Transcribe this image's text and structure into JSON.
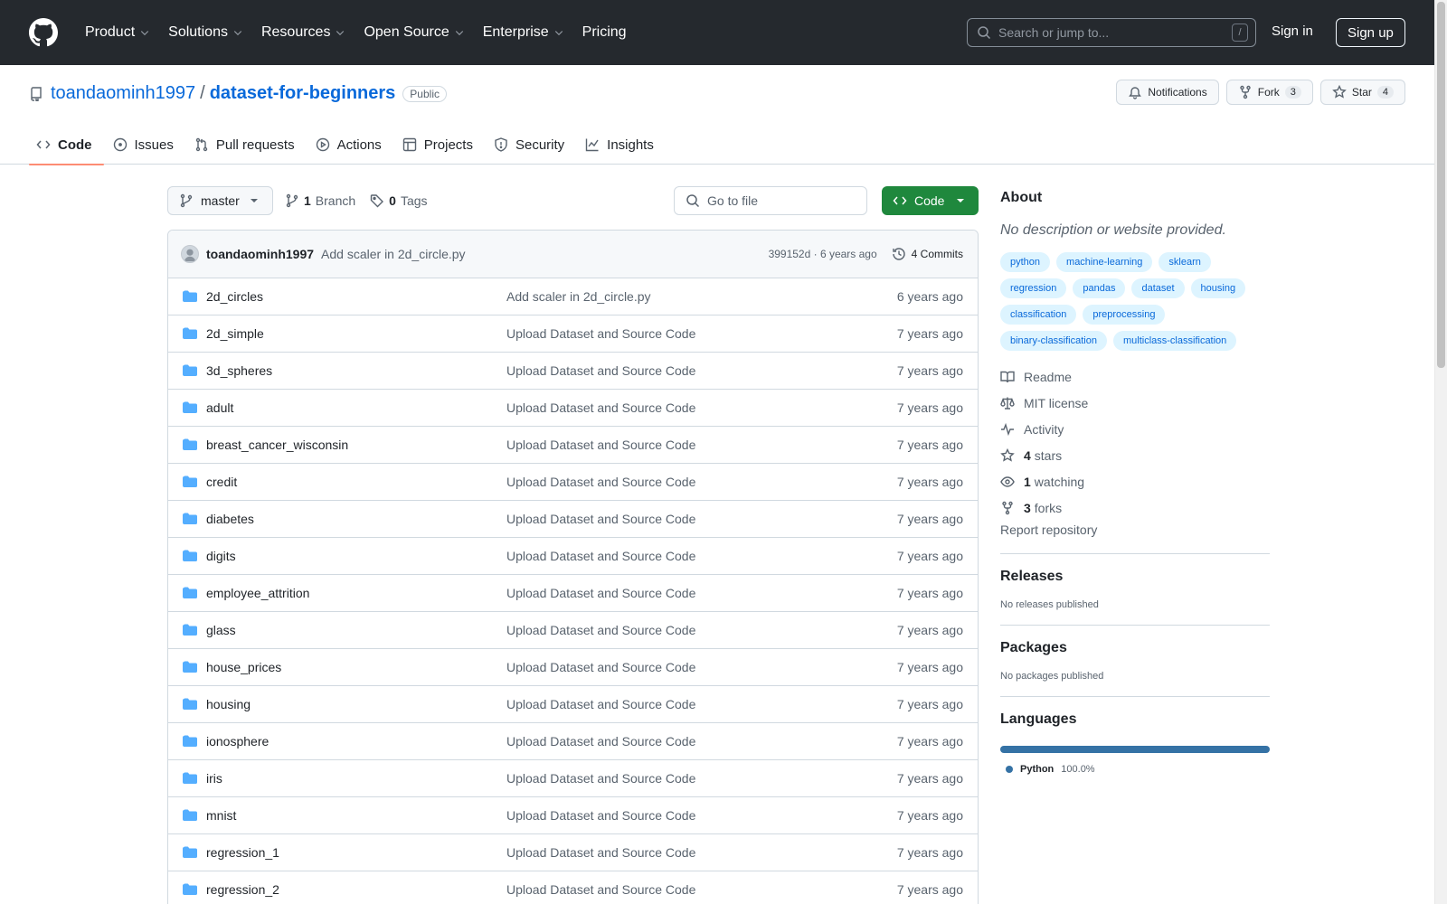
{
  "header": {
    "nav": [
      "Product",
      "Solutions",
      "Resources",
      "Open Source",
      "Enterprise",
      "Pricing"
    ],
    "search_placeholder": "Search or jump to...",
    "search_shortcut": "/",
    "sign_in": "Sign in",
    "sign_up": "Sign up"
  },
  "repo": {
    "owner": "toandaominh1997",
    "separator": "/",
    "name": "dataset-for-beginners",
    "visibility": "Public",
    "notifications_label": "Notifications",
    "fork_label": "Fork",
    "fork_count": "3",
    "star_label": "Star",
    "star_count": "4"
  },
  "tabs": [
    "Code",
    "Issues",
    "Pull requests",
    "Actions",
    "Projects",
    "Security",
    "Insights"
  ],
  "toolbar": {
    "branch": "master",
    "branch_count": "1",
    "branch_label": "Branch",
    "tag_count": "0",
    "tag_label": "Tags",
    "goto_placeholder": "Go to file",
    "code_label": "Code"
  },
  "latest_commit": {
    "author": "toandaominh1997",
    "message": "Add scaler in 2d_circle.py",
    "hash_age": "399152d · 6 years ago",
    "commits": "4 Commits"
  },
  "files": [
    {
      "name": "2d_circles",
      "commit": "Add scaler in 2d_circle.py",
      "age": "6 years ago"
    },
    {
      "name": "2d_simple",
      "commit": "Upload Dataset and Source Code",
      "age": "7 years ago"
    },
    {
      "name": "3d_spheres",
      "commit": "Upload Dataset and Source Code",
      "age": "7 years ago"
    },
    {
      "name": "adult",
      "commit": "Upload Dataset and Source Code",
      "age": "7 years ago"
    },
    {
      "name": "breast_cancer_wisconsin",
      "commit": "Upload Dataset and Source Code",
      "age": "7 years ago"
    },
    {
      "name": "credit",
      "commit": "Upload Dataset and Source Code",
      "age": "7 years ago"
    },
    {
      "name": "diabetes",
      "commit": "Upload Dataset and Source Code",
      "age": "7 years ago"
    },
    {
      "name": "digits",
      "commit": "Upload Dataset and Source Code",
      "age": "7 years ago"
    },
    {
      "name": "employee_attrition",
      "commit": "Upload Dataset and Source Code",
      "age": "7 years ago"
    },
    {
      "name": "glass",
      "commit": "Upload Dataset and Source Code",
      "age": "7 years ago"
    },
    {
      "name": "house_prices",
      "commit": "Upload Dataset and Source Code",
      "age": "7 years ago"
    },
    {
      "name": "housing",
      "commit": "Upload Dataset and Source Code",
      "age": "7 years ago"
    },
    {
      "name": "ionosphere",
      "commit": "Upload Dataset and Source Code",
      "age": "7 years ago"
    },
    {
      "name": "iris",
      "commit": "Upload Dataset and Source Code",
      "age": "7 years ago"
    },
    {
      "name": "mnist",
      "commit": "Upload Dataset and Source Code",
      "age": "7 years ago"
    },
    {
      "name": "regression_1",
      "commit": "Upload Dataset and Source Code",
      "age": "7 years ago"
    },
    {
      "name": "regression_2",
      "commit": "Upload Dataset and Source Code",
      "age": "7 years ago"
    }
  ],
  "about": {
    "title": "About",
    "description": "No description or website provided.",
    "topics": [
      "python",
      "machine-learning",
      "sklearn",
      "regression",
      "pandas",
      "dataset",
      "housing",
      "classification",
      "preprocessing",
      "binary-classification",
      "multiclass-classification"
    ],
    "readme": "Readme",
    "license": "MIT license",
    "activity": "Activity",
    "stars_count": "4",
    "stars_label": "stars",
    "watching_count": "1",
    "watching_label": "watching",
    "forks_count": "3",
    "forks_label": "forks",
    "report": "Report repository"
  },
  "releases": {
    "title": "Releases",
    "text": "No releases published"
  },
  "packages": {
    "title": "Packages",
    "text": "No packages published"
  },
  "languages": {
    "title": "Languages",
    "items": [
      {
        "name": "Python",
        "percent": "100.0%",
        "color": "#3572a5"
      }
    ]
  },
  "colors": {
    "header_bg": "#25292e",
    "link": "#0969da",
    "code_button": "#1f883d",
    "active_tab_underline": "#fd8c73",
    "folder": "#54aeff"
  }
}
